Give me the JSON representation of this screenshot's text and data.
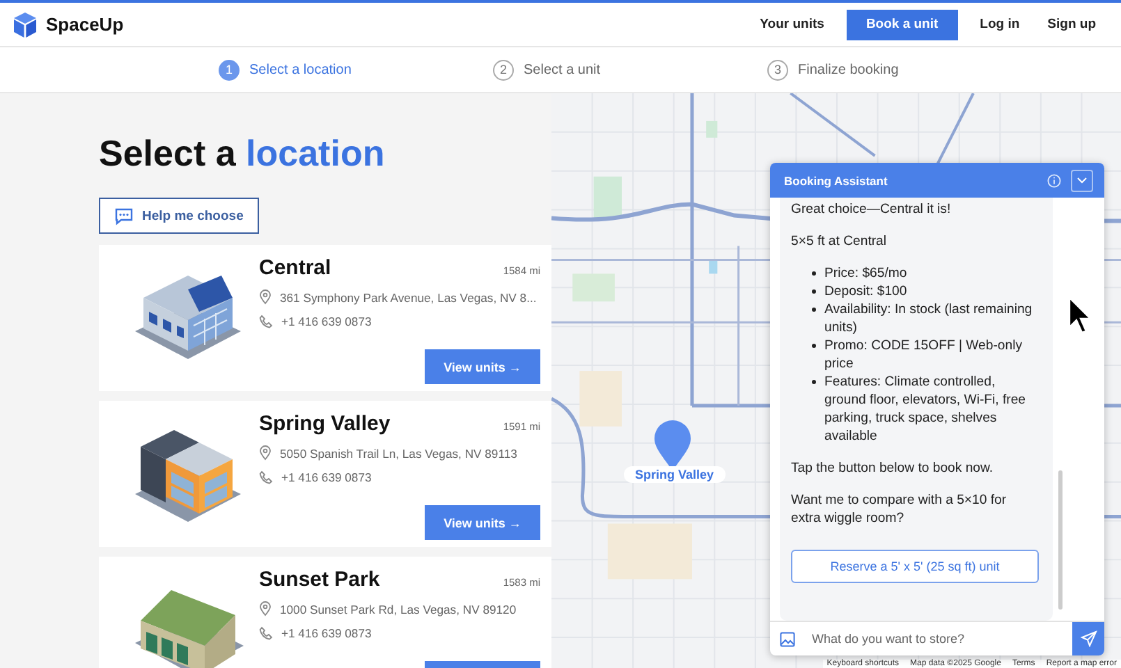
{
  "header": {
    "brand": "SpaceUp",
    "nav": [
      {
        "label": "Your units",
        "kind": "link"
      },
      {
        "label": "Book a unit",
        "kind": "primary"
      },
      {
        "label": "Log in",
        "kind": "link"
      },
      {
        "label": "Sign up",
        "kind": "link"
      }
    ]
  },
  "steps": [
    {
      "number": "1",
      "label": "Select a location",
      "selected": true
    },
    {
      "number": "2",
      "label": "Select a unit",
      "selected": false
    },
    {
      "number": "3",
      "label": "Finalize booking",
      "selected": false
    }
  ],
  "title": {
    "text": "Select a",
    "highlight": "location"
  },
  "help_button": "Help me choose",
  "locations": [
    {
      "name": "Central",
      "distance": "1584 mi",
      "address": "361 Symphony Park Avenue, Las Vegas, NV 8...",
      "phone": "+1 416 639 0873",
      "button": "View units →",
      "kind": "glass"
    },
    {
      "name": "Spring Valley",
      "distance": "1591 mi",
      "address": "5050 Spanish Trail Ln, Las Vegas, NV 89113",
      "phone": "+1 416 639 0873",
      "button": "View units →",
      "kind": "orange"
    },
    {
      "name": "Sunset Park",
      "distance": "1583 mi",
      "address": "1000 Sunset Park Rd, Las Vegas, NV 89120",
      "phone": "+1 416 639 0873",
      "kind": "warehouse"
    }
  ],
  "map": {
    "marker_label": "Spring Valley",
    "footer": [
      "Keyboard shortcuts",
      "Map data ©2025 Google",
      "Terms",
      "Report a map error"
    ]
  },
  "assistant": {
    "title": "Booking Assistant",
    "messages": [
      {
        "kind": "text",
        "text": "Great choice—Central it is!"
      },
      {
        "kind": "text",
        "text": "5×5 ft at Central"
      },
      {
        "kind": "list",
        "items": [
          "Price: $65/mo",
          "Deposit: $100",
          "Availability: In stock (last remaining units)",
          "Promo: CODE 15OFF | Web-only price",
          "Features: Climate controlled, ground floor, elevators, Wi-Fi, free parking, truck space, shelves available"
        ]
      },
      {
        "kind": "text",
        "text": "Tap the button below to book now."
      },
      {
        "kind": "text",
        "text": "Want me to compare with a 5×10 for extra wiggle room?"
      },
      {
        "kind": "button",
        "text": "Reserve a 5' x 5' (25 sq ft) unit"
      }
    ],
    "input": {
      "placeholder": "What do you want to store?"
    }
  }
}
